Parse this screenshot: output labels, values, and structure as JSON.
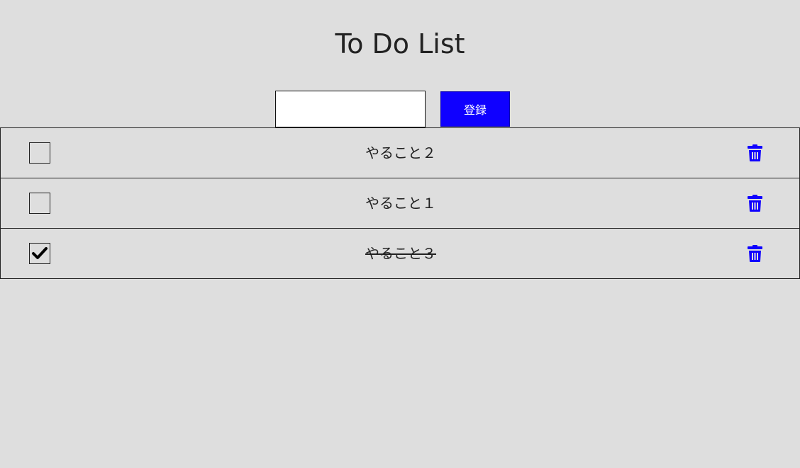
{
  "app": {
    "title": "To Do List"
  },
  "form": {
    "input_value": "",
    "input_placeholder": "",
    "add_button_label": "登録"
  },
  "todos": [
    {
      "text": "やること２",
      "completed": false
    },
    {
      "text": "やること１",
      "completed": false
    },
    {
      "text": "やること３",
      "completed": true
    }
  ],
  "colors": {
    "background": "#dedede",
    "accent": "#0f00ff",
    "text": "#222222"
  },
  "icons": {
    "delete": "trash-icon",
    "check": "checkmark-icon"
  }
}
